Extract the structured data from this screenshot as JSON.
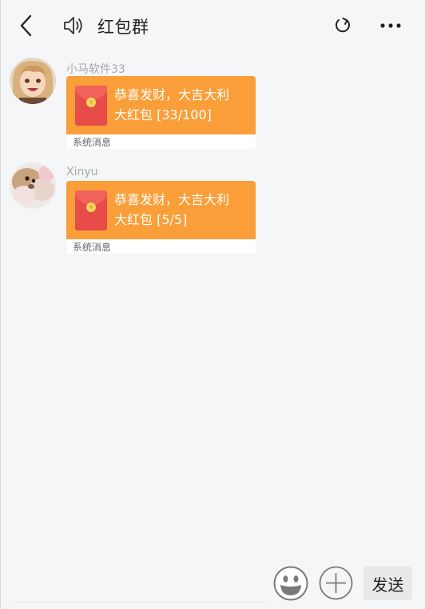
{
  "header": {
    "title": "红包群",
    "back_icon": "chevron-left-icon",
    "speaker_icon": "speaker-icon",
    "refresh_icon": "refresh-icon",
    "more_icon": "more-horizontal-icon"
  },
  "messages": [
    {
      "sender": "小马软件33",
      "packet_greeting": "恭喜发财，大吉大利",
      "packet_info": "大红包 [33/100]",
      "footer": "系统消息"
    },
    {
      "sender": "Xinyu",
      "packet_greeting": "恭喜发财，大吉大利",
      "packet_info": "大红包 [5/5]",
      "footer": "系统消息"
    }
  ],
  "composer": {
    "emoji_icon": "emoji-icon",
    "plus_icon": "plus-circle-icon",
    "send_label": "发送"
  },
  "colors": {
    "packet_orange": "#f99e38",
    "envelope_red": "#e74c48",
    "background": "#f5f6f8"
  }
}
